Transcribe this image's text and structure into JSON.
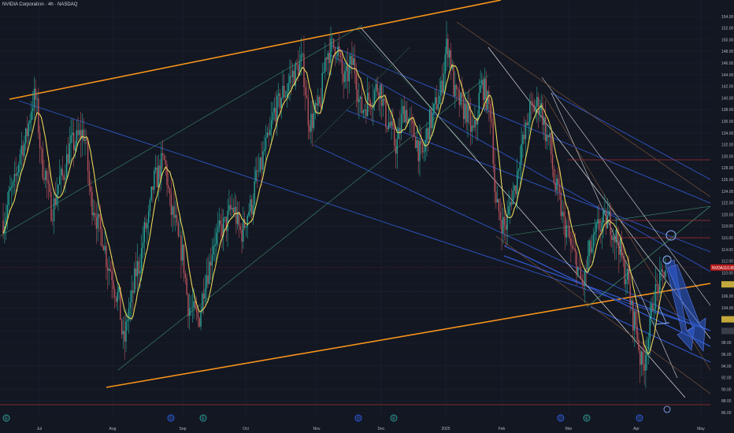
{
  "header": {
    "title": "NVIDIA Corporation · 4h · NASDAQ"
  },
  "chart_data": {
    "type": "candlestick",
    "symbol": "NVDA",
    "interval": "4h",
    "exchange": "NASDAQ",
    "x_ticks": [
      "Jul",
      "Aug",
      "Sep",
      "Oct",
      "Nov",
      "Dec",
      "2025",
      "Feb",
      "Mar",
      "Apr",
      "May"
    ],
    "y_ticks": [
      86,
      88,
      90,
      92,
      94,
      96,
      98,
      100,
      102,
      104,
      106,
      108,
      110,
      112,
      114,
      116,
      118,
      120,
      122,
      124,
      126,
      128,
      130,
      132,
      134,
      136,
      138,
      140,
      142,
      144,
      146,
      148,
      150,
      152,
      154
    ],
    "y_range": [
      86,
      156
    ],
    "last_price": {
      "symbol": "NVDA",
      "value": "110.89"
    },
    "price_path": [
      {
        "t": 0.0,
        "p": 119
      },
      {
        "t": 0.3,
        "p": 124
      },
      {
        "t": 0.7,
        "p": 132
      },
      {
        "t": 1.1,
        "p": 140
      },
      {
        "t": 1.4,
        "p": 128
      },
      {
        "t": 1.7,
        "p": 121
      },
      {
        "t": 2.0,
        "p": 126
      },
      {
        "t": 2.4,
        "p": 132
      },
      {
        "t": 2.8,
        "p": 134
      },
      {
        "t": 3.1,
        "p": 122
      },
      {
        "t": 3.4,
        "p": 117
      },
      {
        "t": 3.7,
        "p": 111
      },
      {
        "t": 4.0,
        "p": 106
      },
      {
        "t": 4.2,
        "p": 98
      },
      {
        "t": 4.4,
        "p": 104
      },
      {
        "t": 4.7,
        "p": 111
      },
      {
        "t": 5.0,
        "p": 118
      },
      {
        "t": 5.3,
        "p": 126
      },
      {
        "t": 5.6,
        "p": 129
      },
      {
        "t": 5.9,
        "p": 120
      },
      {
        "t": 6.2,
        "p": 114
      },
      {
        "t": 6.5,
        "p": 104
      },
      {
        "t": 6.8,
        "p": 102
      },
      {
        "t": 7.1,
        "p": 110
      },
      {
        "t": 7.4,
        "p": 116
      },
      {
        "t": 7.7,
        "p": 118
      },
      {
        "t": 8.0,
        "p": 121
      },
      {
        "t": 8.3,
        "p": 117
      },
      {
        "t": 8.6,
        "p": 121
      },
      {
        "t": 8.9,
        "p": 127
      },
      {
        "t": 9.2,
        "p": 132
      },
      {
        "t": 9.5,
        "p": 138
      },
      {
        "t": 9.8,
        "p": 141
      },
      {
        "t": 10.1,
        "p": 144
      },
      {
        "t": 10.4,
        "p": 146
      },
      {
        "t": 10.7,
        "p": 136
      },
      {
        "t": 11.0,
        "p": 138
      },
      {
        "t": 11.3,
        "p": 148
      },
      {
        "t": 11.6,
        "p": 149
      },
      {
        "t": 11.9,
        "p": 143
      },
      {
        "t": 12.2,
        "p": 146
      },
      {
        "t": 12.5,
        "p": 138
      },
      {
        "t": 12.8,
        "p": 140
      },
      {
        "t": 13.1,
        "p": 142
      },
      {
        "t": 13.4,
        "p": 136
      },
      {
        "t": 13.7,
        "p": 132
      },
      {
        "t": 14.0,
        "p": 138
      },
      {
        "t": 14.3,
        "p": 134
      },
      {
        "t": 14.6,
        "p": 130
      },
      {
        "t": 14.9,
        "p": 136
      },
      {
        "t": 15.2,
        "p": 140
      },
      {
        "t": 15.5,
        "p": 149
      },
      {
        "t": 15.8,
        "p": 140
      },
      {
        "t": 16.1,
        "p": 138
      },
      {
        "t": 16.4,
        "p": 134
      },
      {
        "t": 16.7,
        "p": 142
      },
      {
        "t": 17.0,
        "p": 138
      },
      {
        "t": 17.2,
        "p": 121
      },
      {
        "t": 17.5,
        "p": 118
      },
      {
        "t": 17.8,
        "p": 124
      },
      {
        "t": 18.1,
        "p": 132
      },
      {
        "t": 18.4,
        "p": 138
      },
      {
        "t": 18.7,
        "p": 139
      },
      {
        "t": 19.0,
        "p": 133
      },
      {
        "t": 19.3,
        "p": 124
      },
      {
        "t": 19.6,
        "p": 118
      },
      {
        "t": 19.9,
        "p": 113
      },
      {
        "t": 20.2,
        "p": 108
      },
      {
        "t": 20.5,
        "p": 114
      },
      {
        "t": 20.8,
        "p": 118
      },
      {
        "t": 21.1,
        "p": 119
      },
      {
        "t": 21.4,
        "p": 116
      },
      {
        "t": 21.7,
        "p": 110
      },
      {
        "t": 22.0,
        "p": 102
      },
      {
        "t": 22.3,
        "p": 94
      },
      {
        "t": 22.5,
        "p": 99
      },
      {
        "t": 22.7,
        "p": 106
      },
      {
        "t": 22.9,
        "p": 108
      },
      {
        "t": 23.1,
        "p": 110.89
      }
    ],
    "series": [
      {
        "name": "Price (candles)",
        "color": "#26a69a"
      },
      {
        "name": "Moving average",
        "color": "#e9d659"
      }
    ],
    "markers": [
      "E",
      "D",
      "E",
      "D",
      "E",
      "D",
      "E",
      "D"
    ],
    "colors": {
      "background": "#131722",
      "up": "#26a69a",
      "down": "#b5525b",
      "ma": "#e9d659",
      "channel": "#f7931a",
      "trend_blue": "#2f56c7",
      "teal_line": "#3c8c6b",
      "red_line": "#a83232",
      "white_line": "#d9d9d9",
      "arrow": "#2e5cd6",
      "last_price_tag": "#b71c1c",
      "yellow_tag": "#c4a83b"
    }
  }
}
